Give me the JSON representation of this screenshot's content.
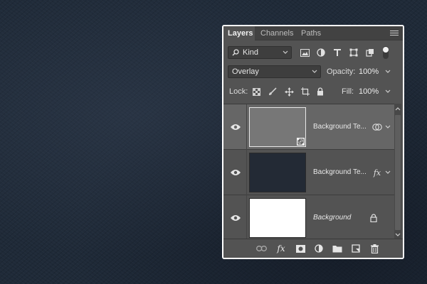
{
  "panel": {
    "tabs": [
      {
        "label": "Layers",
        "active": true
      },
      {
        "label": "Channels",
        "active": false
      },
      {
        "label": "Paths",
        "active": false
      }
    ],
    "filter": {
      "kind_label": "Kind",
      "filter_icons": [
        "image-filter-icon",
        "adjustment-filter-icon",
        "type-filter-icon",
        "shape-filter-icon",
        "smart-object-filter-icon"
      ]
    },
    "blend": {
      "mode": "Overlay",
      "opacity_label": "Opacity:",
      "opacity_value": "100%"
    },
    "lock": {
      "label": "Lock:",
      "icons": [
        "lock-transparent-icon",
        "lock-paint-icon",
        "lock-position-icon",
        "lock-artboard-icon",
        "lock-all-icon"
      ],
      "fill_label": "Fill:",
      "fill_value": "100%"
    },
    "layers": [
      {
        "name": "Background Te...",
        "thumb_color": "#777777",
        "selected": true,
        "badge": "smart-object-icon",
        "italic": false
      },
      {
        "name": "Background Te...",
        "thumb_color": "#232a35",
        "selected": false,
        "badge": "fx",
        "italic": false
      },
      {
        "name": "Background",
        "thumb_color": "#ffffff",
        "selected": false,
        "badge": "lock-icon",
        "italic": true
      }
    ],
    "footer_icons": [
      "link-icon",
      "fx-icon",
      "mask-icon",
      "adjustment-icon",
      "folder-icon",
      "new-layer-icon",
      "trash-icon"
    ],
    "fx_text": "fx",
    "colors": {
      "panel_bg": "#535353",
      "tab_bar_bg": "#424242",
      "selected_layer_bg": "#666666",
      "background_texture": "#1f2a38"
    }
  }
}
